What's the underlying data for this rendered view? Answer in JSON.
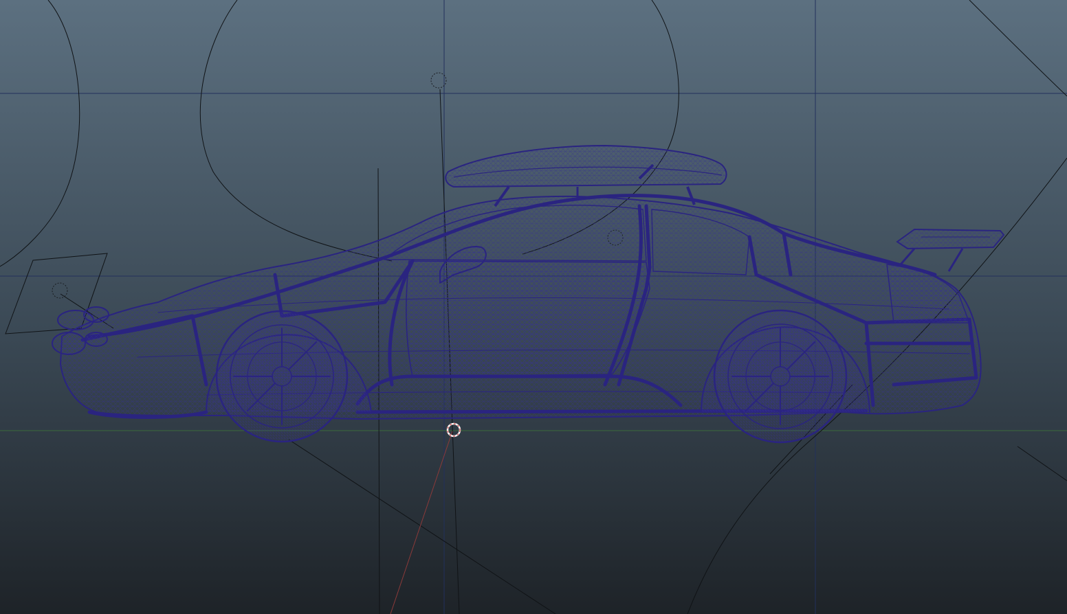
{
  "viewport": {
    "background_top": "#5c7080",
    "background_bottom": "#1e2328",
    "grid_line_color": "#22305c",
    "ground_line_color": "#3c6a3c",
    "guide_line_color": "#101316",
    "axis_line_color": "#8b3a3a",
    "wireframe_color": "#2a2480",
    "wireframe_fill": "#35308f",
    "pivot_color": "#ffffff",
    "pivot_accent": "#c93a3a"
  },
  "objects": {
    "car": {
      "icon": "car-wireframe"
    },
    "roof_box": {
      "icon": "roof-box-wireframe"
    },
    "spoiler": {
      "icon": "rear-wing-wireframe"
    },
    "pivot": {
      "icon": "manipulator-pivot-icon"
    }
  }
}
